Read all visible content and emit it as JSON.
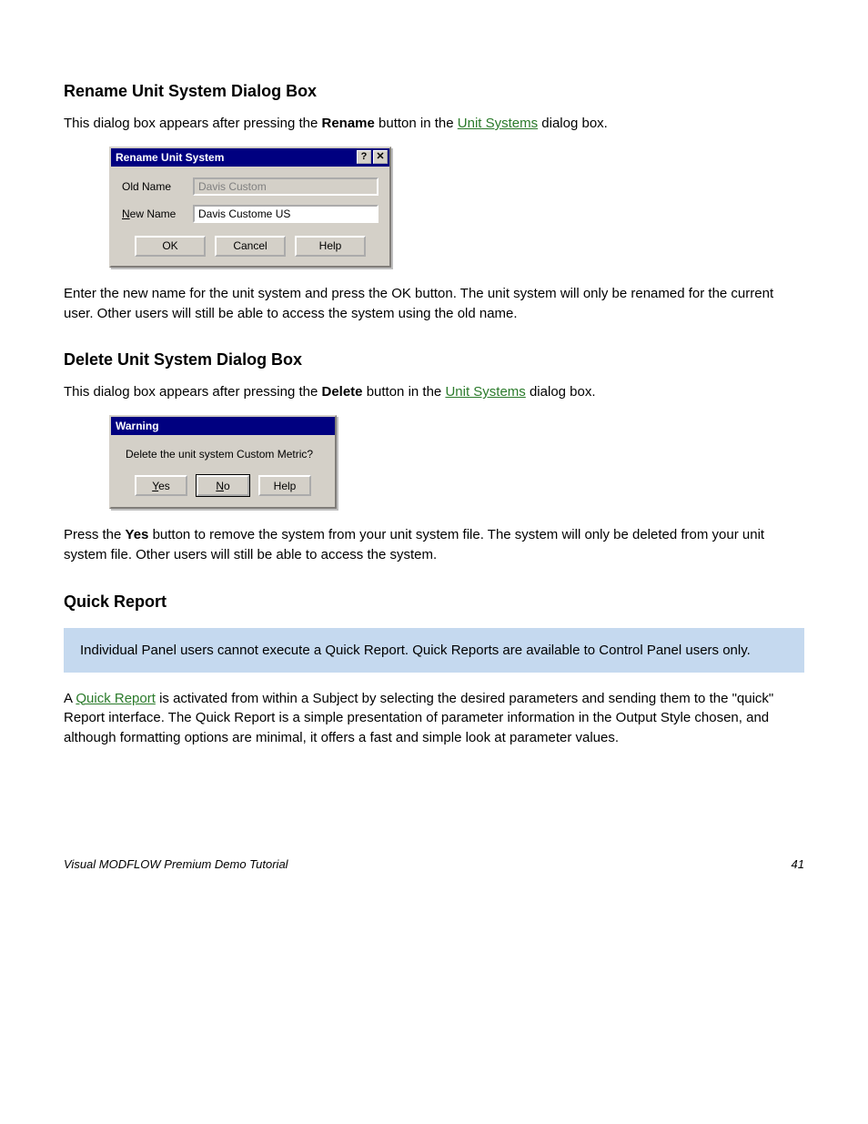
{
  "section1": {
    "heading": "Rename Unit System Dialog Box",
    "para1_pre": "This dialog box appears after pressing the ",
    "para1_bold": "Rename",
    "para1_mid": " button in the ",
    "para1_link": "Unit Systems",
    "para1_post": " dialog box.",
    "para2": "Enter the new name for the unit system and press the OK button. The unit system will only be renamed for the current user. Other users will still be able to access the system using the old name."
  },
  "rename_dialog": {
    "title": "Rename Unit System",
    "old_label": "Old Name",
    "new_label_u": "N",
    "new_label_rest": "ew Name",
    "old_value": "Davis Custom",
    "new_value": "Davis Custome US",
    "ok": "OK",
    "cancel": "Cancel",
    "help": "Help"
  },
  "section2": {
    "heading": "Delete Unit System Dialog Box",
    "para1_pre": "This dialog box appears after pressing the ",
    "para1_bold": "Delete",
    "para1_mid": " button in the ",
    "para1_link": "Unit Systems",
    "para1_post": " dialog box.",
    "para2_pre": "Press the ",
    "para2_bold": "Yes",
    "para2_post": " button to remove the system from your unit system file. The system will only be deleted from your unit system file. Other users will still be able to access the system."
  },
  "warning_dialog": {
    "title": "Warning",
    "message": "Delete the unit system Custom Metric?",
    "yes_u": "Y",
    "yes_rest": "es",
    "no_u": "N",
    "no_rest": "o",
    "help": "Help"
  },
  "section3": {
    "heading": "Quick Report",
    "callout": "Individual Panel users cannot execute a Quick Report. Quick Reports are available to Control Panel users only.",
    "para1_pre": "A ",
    "para1_link": "Quick Report",
    "para1_post": " is activated from within a Subject by selecting the desired parameters and sending them to the \"quick\" Report interface. The Quick Report is a simple presentation of parameter information in the Output Style chosen, and although formatting options are minimal, it offers a fast and simple look at parameter values."
  },
  "footer": {
    "left": "Visual MODFLOW Premium Demo Tutorial",
    "right": "41"
  }
}
